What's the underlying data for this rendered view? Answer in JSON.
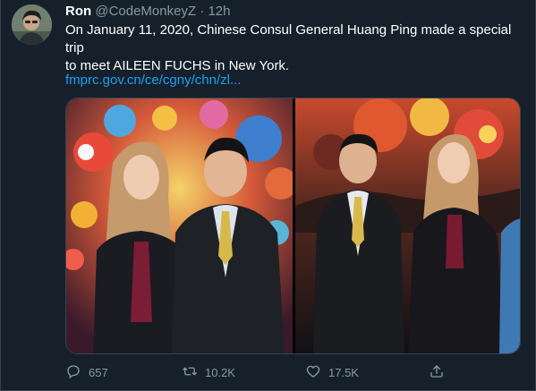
{
  "user": {
    "name": "Ron",
    "handle": "@CodeMonkeyZ",
    "separator": "·",
    "time": "12h"
  },
  "tweet": {
    "text_line1": "On January 11, 2020, Chinese Consul General Huang Ping made a special trip",
    "text_line2": "to meet AILEEN FUCHS in New York.",
    "link": "fmprc.gov.cn/ce/cgny/chn/zl..."
  },
  "actions": {
    "reply_count": "657",
    "retweet_count": "10.2K",
    "like_count": "17.5K"
  },
  "icons": {
    "reply": "reply-icon",
    "retweet": "retweet-icon",
    "like": "like-icon",
    "share": "share-icon"
  },
  "colors": {
    "background": "#15202b",
    "secondary_text": "#8899a6",
    "link": "#1da1f2",
    "border": "#38444d"
  }
}
